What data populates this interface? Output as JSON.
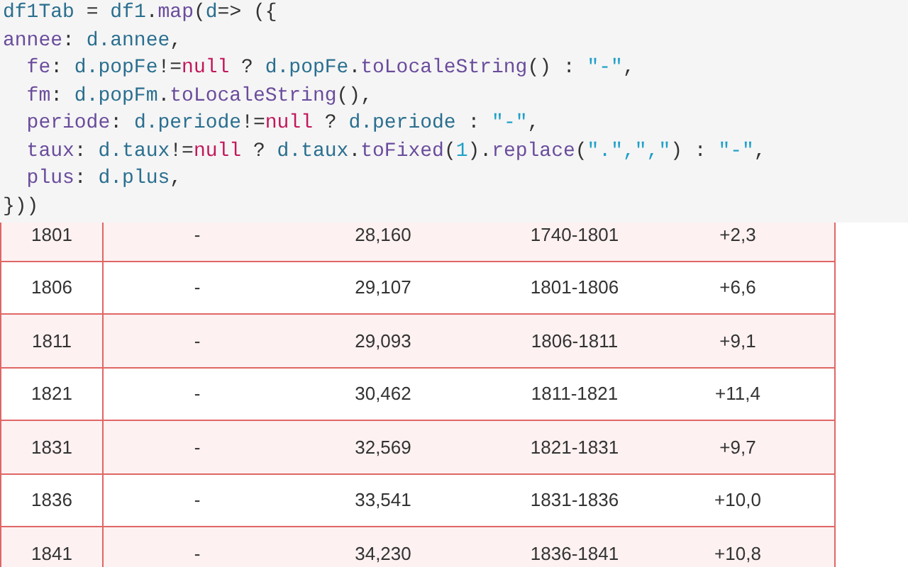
{
  "code": {
    "lines": [
      [
        {
          "kind": "var",
          "text": "df1Tab"
        },
        {
          "kind": "plain",
          "text": " = "
        },
        {
          "kind": "var",
          "text": "df1"
        },
        {
          "kind": "plain",
          "text": "."
        },
        {
          "kind": "fn",
          "text": "map"
        },
        {
          "kind": "plain",
          "text": "("
        },
        {
          "kind": "var",
          "text": "d"
        },
        {
          "kind": "plain",
          "text": "=> ({"
        }
      ],
      [
        {
          "kind": "key",
          "text": "annee"
        },
        {
          "kind": "plain",
          "text": ": "
        },
        {
          "kind": "var",
          "text": "d.annee"
        },
        {
          "kind": "plain",
          "text": ","
        }
      ],
      [
        {
          "kind": "key",
          "text": "  fe"
        },
        {
          "kind": "plain",
          "text": ": "
        },
        {
          "kind": "var",
          "text": "d.popFe"
        },
        {
          "kind": "plain",
          "text": "!="
        },
        {
          "kind": "keyword",
          "text": "null"
        },
        {
          "kind": "plain",
          "text": " ? "
        },
        {
          "kind": "var",
          "text": "d.popFe"
        },
        {
          "kind": "plain",
          "text": "."
        },
        {
          "kind": "fn",
          "text": "toLocaleString"
        },
        {
          "kind": "plain",
          "text": "() : "
        },
        {
          "kind": "string",
          "text": "\"-\""
        },
        {
          "kind": "plain",
          "text": ","
        }
      ],
      [
        {
          "kind": "key",
          "text": "  fm"
        },
        {
          "kind": "plain",
          "text": ": "
        },
        {
          "kind": "var",
          "text": "d.popFm"
        },
        {
          "kind": "plain",
          "text": "."
        },
        {
          "kind": "fn",
          "text": "toLocaleString"
        },
        {
          "kind": "plain",
          "text": "(),"
        }
      ],
      [
        {
          "kind": "key",
          "text": "  periode"
        },
        {
          "kind": "plain",
          "text": ": "
        },
        {
          "kind": "var",
          "text": "d.periode"
        },
        {
          "kind": "plain",
          "text": "!="
        },
        {
          "kind": "keyword",
          "text": "null"
        },
        {
          "kind": "plain",
          "text": " ? "
        },
        {
          "kind": "var",
          "text": "d.periode"
        },
        {
          "kind": "plain",
          "text": " : "
        },
        {
          "kind": "string",
          "text": "\"-\""
        },
        {
          "kind": "plain",
          "text": ","
        }
      ],
      [
        {
          "kind": "key",
          "text": "  taux"
        },
        {
          "kind": "plain",
          "text": ": "
        },
        {
          "kind": "var",
          "text": "d.taux"
        },
        {
          "kind": "plain",
          "text": "!="
        },
        {
          "kind": "keyword",
          "text": "null"
        },
        {
          "kind": "plain",
          "text": " ? "
        },
        {
          "kind": "var",
          "text": "d.taux"
        },
        {
          "kind": "plain",
          "text": "."
        },
        {
          "kind": "fn",
          "text": "toFixed"
        },
        {
          "kind": "plain",
          "text": "("
        },
        {
          "kind": "number",
          "text": "1"
        },
        {
          "kind": "plain",
          "text": ")."
        },
        {
          "kind": "fn",
          "text": "replace"
        },
        {
          "kind": "plain",
          "text": "("
        },
        {
          "kind": "string",
          "text": "\".\",\",\""
        },
        {
          "kind": "plain",
          "text": ") : "
        },
        {
          "kind": "string",
          "text": "\"-\""
        },
        {
          "kind": "plain",
          "text": ","
        }
      ],
      [
        {
          "kind": "key",
          "text": "  plus"
        },
        {
          "kind": "plain",
          "text": ": "
        },
        {
          "kind": "var",
          "text": "d.plus"
        },
        {
          "kind": "plain",
          "text": ","
        }
      ],
      [
        {
          "kind": "plain",
          "text": "}))"
        }
      ]
    ]
  },
  "table": {
    "rows": [
      [
        "1801",
        "-",
        "28,160",
        "1740-1801",
        "+2,3"
      ],
      [
        "1806",
        "-",
        "29,107",
        "1801-1806",
        "+6,6"
      ],
      [
        "1811",
        "-",
        "29,093",
        "1806-1811",
        "+9,1"
      ],
      [
        "1821",
        "-",
        "30,462",
        "1811-1821",
        "+11,4"
      ],
      [
        "1831",
        "-",
        "32,569",
        "1821-1831",
        "+9,7"
      ],
      [
        "1836",
        "-",
        "33,541",
        "1831-1836",
        "+10,0"
      ],
      [
        "1841",
        "-",
        "34,230",
        "1836-1841",
        "+10,8"
      ]
    ]
  }
}
